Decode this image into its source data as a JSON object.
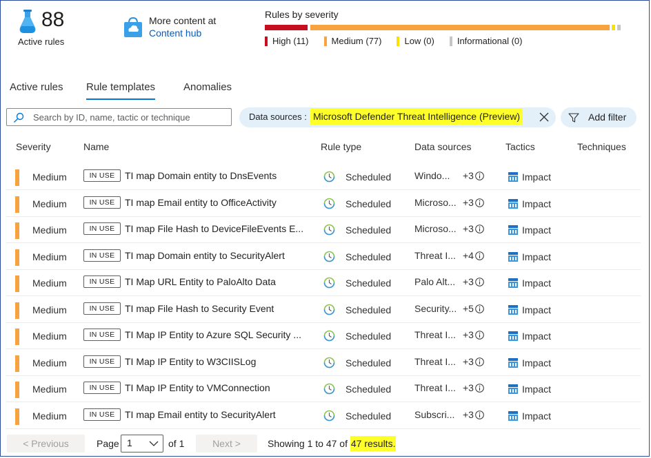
{
  "header": {
    "active_count": "88",
    "active_label": "Active rules",
    "hub_line1": "More content at",
    "hub_line2": "Content hub",
    "severity_title": "Rules by severity",
    "severity": [
      {
        "label": "High (11)",
        "count": 11,
        "color": "#c50f1f"
      },
      {
        "label": "Medium (77)",
        "count": 77,
        "color": "#f7a33f"
      },
      {
        "label": "Low (0)",
        "count": 0,
        "color": "#fce100"
      },
      {
        "label": "Informational (0)",
        "count": 0,
        "color": "#c8c6c4"
      }
    ]
  },
  "tabs": [
    {
      "label": "Active rules",
      "selected": false
    },
    {
      "label": "Rule templates",
      "selected": true
    },
    {
      "label": "Anomalies",
      "selected": false
    }
  ],
  "search": {
    "placeholder": "Search by ID, name, tactic or technique"
  },
  "filter": {
    "label": "Data sources :",
    "value": "Microsoft Defender Threat Intelligence (Preview)",
    "add_filter": "Add filter"
  },
  "table": {
    "headers": [
      "Severity",
      "Name",
      "Rule type",
      "Data sources",
      "Tactics",
      "Techniques"
    ],
    "rows": [
      {
        "severity": "Medium",
        "badge": "IN USE",
        "name": "TI map Domain entity to DnsEvents",
        "rule_type": "Scheduled",
        "ds": "Windo...",
        "ds_more": "+3",
        "tactic": "Impact"
      },
      {
        "severity": "Medium",
        "badge": "IN USE",
        "name": "TI map Email entity to OfficeActivity",
        "rule_type": "Scheduled",
        "ds": "Microso...",
        "ds_more": "+3",
        "tactic": "Impact"
      },
      {
        "severity": "Medium",
        "badge": "IN USE",
        "name": "TI map File Hash to DeviceFileEvents E...",
        "rule_type": "Scheduled",
        "ds": "Microso...",
        "ds_more": "+3",
        "tactic": "Impact"
      },
      {
        "severity": "Medium",
        "badge": "IN USE",
        "name": "TI map Domain entity to SecurityAlert",
        "rule_type": "Scheduled",
        "ds": "Threat I...",
        "ds_more": "+4",
        "tactic": "Impact"
      },
      {
        "severity": "Medium",
        "badge": "IN USE",
        "name": "TI Map URL Entity to PaloAlto Data",
        "rule_type": "Scheduled",
        "ds": "Palo Alt...",
        "ds_more": "+3",
        "tactic": "Impact"
      },
      {
        "severity": "Medium",
        "badge": "IN USE",
        "name": "TI map File Hash to Security Event",
        "rule_type": "Scheduled",
        "ds": "Security...",
        "ds_more": "+5",
        "tactic": "Impact"
      },
      {
        "severity": "Medium",
        "badge": "IN USE",
        "name": "TI Map IP Entity to Azure SQL Security ...",
        "rule_type": "Scheduled",
        "ds": "Threat I...",
        "ds_more": "+3",
        "tactic": "Impact"
      },
      {
        "severity": "Medium",
        "badge": "IN USE",
        "name": "TI Map IP Entity to W3CIISLog",
        "rule_type": "Scheduled",
        "ds": "Threat I...",
        "ds_more": "+3",
        "tactic": "Impact"
      },
      {
        "severity": "Medium",
        "badge": "IN USE",
        "name": "TI Map IP Entity to VMConnection",
        "rule_type": "Scheduled",
        "ds": "Threat I...",
        "ds_more": "+3",
        "tactic": "Impact"
      },
      {
        "severity": "Medium",
        "badge": "IN USE",
        "name": "TI map Email entity to SecurityAlert",
        "rule_type": "Scheduled",
        "ds": "Subscri...",
        "ds_more": "+3",
        "tactic": "Impact"
      }
    ]
  },
  "pagination": {
    "previous": "< Previous",
    "page_label": "Page",
    "page_value": "1",
    "of_label": "of 1",
    "next": "Next >",
    "showing_prefix": "Showing 1 to 47 of",
    "showing_highlight": "47 results."
  },
  "colors": {
    "accent": "#0078d4",
    "medium": "#f7a33f",
    "highlight": "#ffff2a",
    "pill_bg": "#e3f0fa"
  },
  "icons": {
    "active_rules": "flask-icon",
    "hub": "content-hub-bag-icon",
    "search": "search-icon",
    "clear": "close-icon",
    "filter": "funnel-icon",
    "rule_type": "clock-icon",
    "info": "info-icon",
    "tactic": "impact-icon",
    "dropdown": "chevron-down-icon"
  }
}
